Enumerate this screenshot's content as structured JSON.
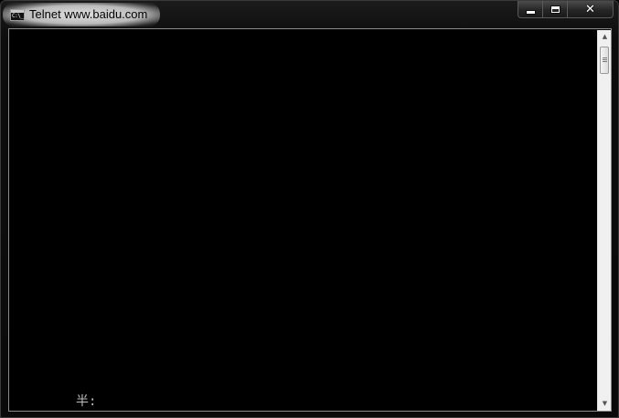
{
  "window": {
    "title": "Telnet www.baidu.com",
    "icon": "console-icon",
    "icon_glyph": "C:\\_"
  },
  "controls": {
    "minimize": "minimize-icon",
    "maximize": "maximize-icon",
    "close": "close-icon",
    "close_glyph": "✕"
  },
  "console": {
    "lines": [
      "半:"
    ]
  },
  "scrollbar": {
    "up_arrow": "▲",
    "down_arrow": "▼",
    "position": 0
  },
  "colors": {
    "console_background": "#000000",
    "console_text": "#c0c0c0",
    "scrollbar_track": "#f0f0f0",
    "title_glow": "#e0e0e0"
  }
}
